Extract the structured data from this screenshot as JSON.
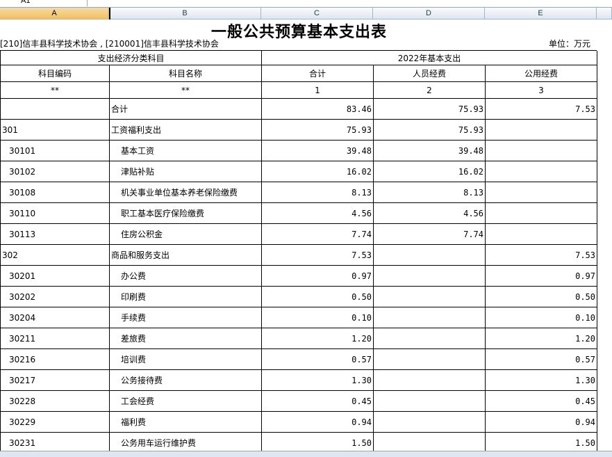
{
  "window": {
    "name_box": "A1",
    "formula": ""
  },
  "columns": [
    "A",
    "B",
    "C",
    "D",
    "E"
  ],
  "sheet": {
    "title": "一般公共预算基本支出表",
    "org_label": "[210]信丰县科学技术协会 , [210001]信丰县科学技术协会",
    "unit_label": "单位：万元",
    "group_headers": {
      "left": "支出经济分类科目",
      "right": "2022年基本支出"
    },
    "headers": [
      "科目编码",
      "科目名称",
      "合计",
      "人员经费",
      "公用经费"
    ],
    "index_row": [
      "**",
      "**",
      "1",
      "2",
      "3"
    ],
    "rows": [
      {
        "code": "",
        "name": "合计",
        "total": "83.46",
        "personnel": "75.93",
        "public": "7.53",
        "level": 0
      },
      {
        "code": "301",
        "name": "工资福利支出",
        "total": "75.93",
        "personnel": "75.93",
        "public": "",
        "level": 0
      },
      {
        "code": "30101",
        "name": "基本工资",
        "total": "39.48",
        "personnel": "39.48",
        "public": "",
        "level": 1
      },
      {
        "code": "30102",
        "name": "津贴补贴",
        "total": "16.02",
        "personnel": "16.02",
        "public": "",
        "level": 1
      },
      {
        "code": "30108",
        "name": "机关事业单位基本养老保险缴费",
        "total": "8.13",
        "personnel": "8.13",
        "public": "",
        "level": 1
      },
      {
        "code": "30110",
        "name": "职工基本医疗保险缴费",
        "total": "4.56",
        "personnel": "4.56",
        "public": "",
        "level": 1
      },
      {
        "code": "30113",
        "name": "住房公积金",
        "total": "7.74",
        "personnel": "7.74",
        "public": "",
        "level": 1
      },
      {
        "code": "302",
        "name": "商品和服务支出",
        "total": "7.53",
        "personnel": "",
        "public": "7.53",
        "level": 0
      },
      {
        "code": "30201",
        "name": "办公费",
        "total": "0.97",
        "personnel": "",
        "public": "0.97",
        "level": 1
      },
      {
        "code": "30202",
        "name": "印刷费",
        "total": "0.50",
        "personnel": "",
        "public": "0.50",
        "level": 1
      },
      {
        "code": "30204",
        "name": "手续费",
        "total": "0.10",
        "personnel": "",
        "public": "0.10",
        "level": 1
      },
      {
        "code": "30211",
        "name": "差旅费",
        "total": "1.20",
        "personnel": "",
        "public": "1.20",
        "level": 1
      },
      {
        "code": "30216",
        "name": "培训费",
        "total": "0.57",
        "personnel": "",
        "public": "0.57",
        "level": 1
      },
      {
        "code": "30217",
        "name": "公务接待费",
        "total": "1.30",
        "personnel": "",
        "public": "1.30",
        "level": 1
      },
      {
        "code": "30228",
        "name": "工会经费",
        "total": "0.45",
        "personnel": "",
        "public": "0.45",
        "level": 1
      },
      {
        "code": "30229",
        "name": "福利费",
        "total": "0.94",
        "personnel": "",
        "public": "0.94",
        "level": 1
      },
      {
        "code": "30231",
        "name": "公务用车运行维护费",
        "total": "1.50",
        "personnel": "",
        "public": "1.50",
        "level": 1
      }
    ]
  }
}
